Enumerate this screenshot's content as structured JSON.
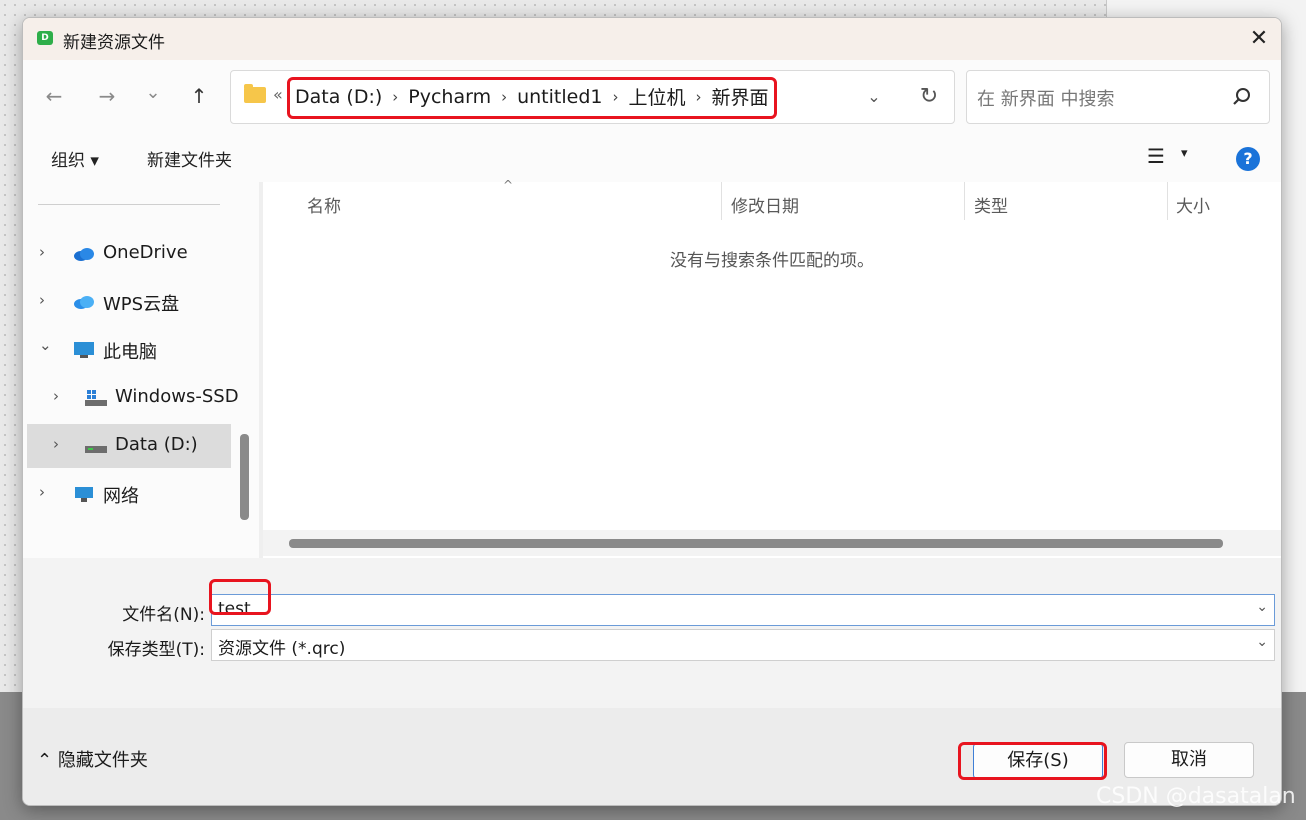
{
  "dialog": {
    "title": "新建资源文件",
    "app_icon_letter": "D",
    "close_symbol": "✕"
  },
  "nav_buttons": {
    "back_symbol": "←",
    "forward_symbol": "→",
    "history_symbol": "⌄",
    "up_symbol": "↑"
  },
  "address": {
    "overflow_symbol": "«",
    "separator": "›",
    "crumbs": [
      "Data (D:)",
      "Pycharm",
      "untitled1",
      "上位机",
      "新界面"
    ],
    "dropdown_symbol": "⌄",
    "refresh_symbol": "↻"
  },
  "search": {
    "placeholder": "在 新界面 中搜索"
  },
  "toolbar": {
    "organize": "组织 ▾",
    "new_folder": "新建文件夹",
    "view_symbol": "☰",
    "view_dd": "▾",
    "help": "?"
  },
  "nav_pane": {
    "items": [
      {
        "label": "OneDrive",
        "chevron": "›",
        "icon": "onedrive-cloud-icon"
      },
      {
        "label": "WPS云盘",
        "chevron": "›",
        "icon": "wps-cloud-icon"
      },
      {
        "label": "此电脑",
        "chevron": "⌄",
        "icon": "this-pc-icon"
      },
      {
        "label": "Windows-SSD",
        "chevron": "›",
        "icon": "drive-c-icon"
      },
      {
        "label": "Data (D:)",
        "chevron": "›",
        "icon": "drive-d-icon"
      },
      {
        "label": "网络",
        "chevron": "›",
        "icon": "network-icon"
      }
    ]
  },
  "file_list": {
    "columns": [
      "名称",
      "修改日期",
      "类型",
      "大小"
    ],
    "sort_caret": "^",
    "empty_message": "没有与搜索条件匹配的项。"
  },
  "form": {
    "filename_label": "文件名(N):",
    "filename_value": "test",
    "filetype_label": "保存类型(T):",
    "filetype_value": "资源文件 (*.qrc)",
    "dd_symbol": "⌄"
  },
  "footer": {
    "hide_folders": "隐藏文件夹",
    "hide_symbol": "⌃",
    "save_label": "保存(S)",
    "cancel_label": "取消"
  },
  "watermark": "CSDN @dasatalan",
  "colors": {
    "accent": "#1a73d9",
    "highlight_red": "#e8141f",
    "folder_yellow": "#f6c64a"
  }
}
